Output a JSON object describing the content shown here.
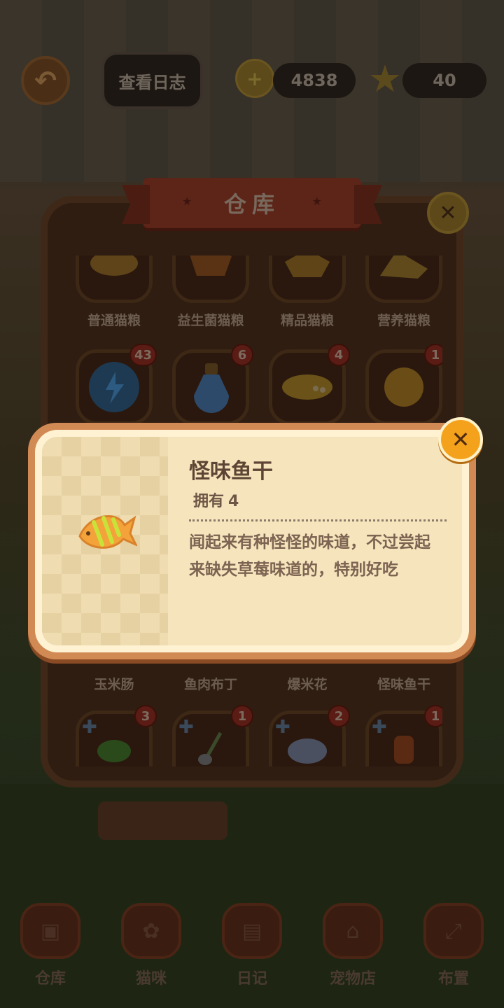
{
  "header": {
    "log_button": "查看日志",
    "coins": "4838",
    "stars": "40"
  },
  "warehouse": {
    "title": "仓库",
    "row1": [
      {
        "name": "普通猫粮"
      },
      {
        "name": "益生菌猫粮"
      },
      {
        "name": "精品猫粮"
      },
      {
        "name": "营养猫粮"
      }
    ],
    "row2": [
      {
        "count": "43"
      },
      {
        "count": "6"
      },
      {
        "count": "4"
      },
      {
        "count": "1"
      }
    ],
    "row3": [
      {
        "name": "玉米肠"
      },
      {
        "name": "鱼肉布丁"
      },
      {
        "name": "爆米花"
      },
      {
        "name": "怪味鱼干"
      }
    ],
    "row4": [
      {
        "count": "3"
      },
      {
        "count": "1"
      },
      {
        "count": "2"
      },
      {
        "count": "1"
      }
    ]
  },
  "detail": {
    "title": "怪味鱼干",
    "owned_label": "拥有",
    "owned_count": "4",
    "description": "闻起来有种怪怪的味道，不过尝起来缺失草莓味道的，特别好吃"
  },
  "nav": [
    {
      "label": "仓库",
      "icon": "box-icon"
    },
    {
      "label": "猫咪",
      "icon": "paw-icon"
    },
    {
      "label": "日记",
      "icon": "diary-icon"
    },
    {
      "label": "宠物店",
      "icon": "shop-icon"
    },
    {
      "label": "布置",
      "icon": "expand-icon"
    }
  ],
  "colors": {
    "popup_border": "#d28a55",
    "popup_bg": "#f6e5bc",
    "close_button": "#f4a21c"
  }
}
